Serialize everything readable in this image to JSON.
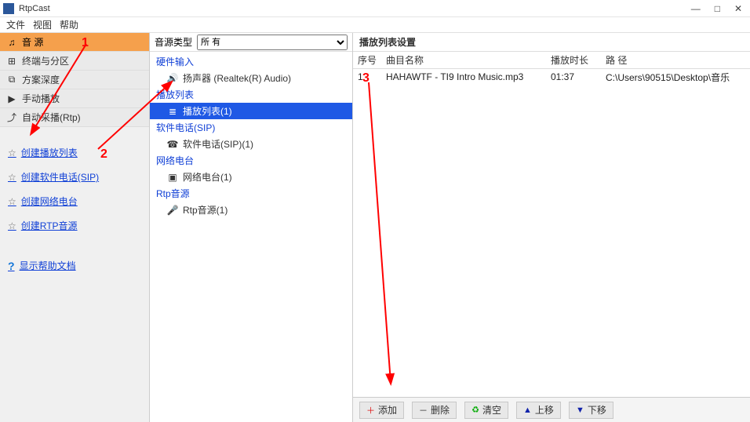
{
  "app": {
    "title": "RtpCast"
  },
  "menubar": [
    "文件",
    "视图",
    "帮助"
  ],
  "sidebar_nav": [
    {
      "icon": "♫",
      "label": "音 源",
      "active": true
    },
    {
      "icon": "⊞",
      "label": "终端与分区"
    },
    {
      "icon": "⧉",
      "label": "方案深度"
    },
    {
      "icon": "▶",
      "label": "手动播放"
    },
    {
      "icon": "⤴",
      "label": "自动采播(Rtp)"
    }
  ],
  "sidebar_links": [
    "创建播放列表",
    "创建软件电话(SIP)",
    "创建网络电台",
    "创建RTP音源"
  ],
  "sidebar_help": "显示帮助文档",
  "middle": {
    "filter_label": "音源类型",
    "filter_value": "所 有",
    "groups": [
      {
        "label": "硬件输入",
        "items": [
          {
            "icon": "🔊",
            "label": "扬声器 (Realtek(R) Audio)"
          }
        ]
      },
      {
        "label": "播放列表",
        "items": [
          {
            "icon": "≣",
            "label": "播放列表(1)",
            "selected": true
          }
        ]
      },
      {
        "label": "软件电话(SIP)",
        "items": [
          {
            "icon": "☎",
            "label": "软件电话(SIP)(1)"
          }
        ]
      },
      {
        "label": "网络电台",
        "items": [
          {
            "icon": "▣",
            "label": "网络电台(1)"
          }
        ]
      },
      {
        "label": "Rtp音源",
        "items": [
          {
            "icon": "🎤",
            "label": "Rtp音源(1)"
          }
        ]
      }
    ]
  },
  "right": {
    "title": "播放列表设置",
    "columns": {
      "idx": "序号",
      "name": "曲目名称",
      "dur": "播放时长",
      "path": "路 径"
    },
    "rows": [
      {
        "idx": "1",
        "name": "HAHAWTF - TI9 Intro Music.mp3",
        "dur": "01:37",
        "path": "C:\\Users\\90515\\Desktop\\音乐"
      }
    ],
    "buttons": {
      "add": "添加",
      "del": "删除",
      "clear": "清空",
      "up": "上移",
      "down": "下移"
    }
  },
  "annotations": {
    "a1": "1",
    "a2": "2",
    "a3": "3"
  }
}
